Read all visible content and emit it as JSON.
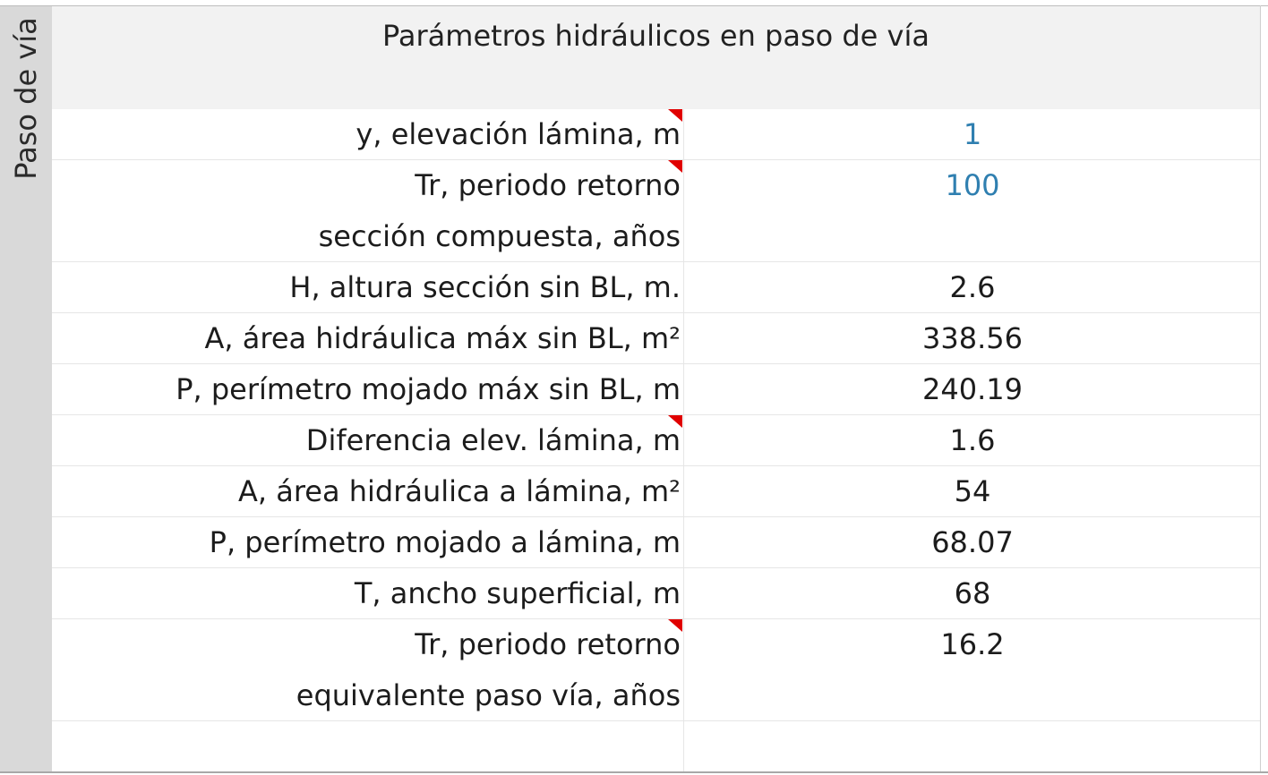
{
  "side_label": "Paso de vía",
  "header_title": "Parámetros hidráulicos en paso de vía",
  "rows": [
    {
      "label1": "y, elevación lámina, m",
      "label2": "",
      "value": "1",
      "input": true,
      "flag": true
    },
    {
      "label1": "Tr, periodo retorno",
      "label2": "sección compuesta, años",
      "value": "100",
      "input": true,
      "flag": true
    },
    {
      "label1": "H, altura sección sin BL, m.",
      "label2": "",
      "value": "2.6",
      "input": false,
      "flag": false
    },
    {
      "label1": "A, área hidráulica máx sin BL, m²",
      "label2": "",
      "value": "338.56",
      "input": false,
      "flag": false
    },
    {
      "label1": "P, perímetro mojado máx sin BL, m",
      "label2": "",
      "value": "240.19",
      "input": false,
      "flag": false
    },
    {
      "label1": "Diferencia elev. lámina, m",
      "label2": "",
      "value": "1.6",
      "input": false,
      "flag": true
    },
    {
      "label1": "A, área hidráulica a lámina, m²",
      "label2": "",
      "value": "54",
      "input": false,
      "flag": false
    },
    {
      "label1": "P, perímetro mojado a lámina, m",
      "label2": "",
      "value": "68.07",
      "input": false,
      "flag": false
    },
    {
      "label1": "T, ancho superficial, m",
      "label2": "",
      "value": "68",
      "input": false,
      "flag": false
    },
    {
      "label1": "Tr, periodo retorno",
      "label2": "equivalente paso vía, años",
      "value": "16.2",
      "input": false,
      "flag": true
    }
  ]
}
